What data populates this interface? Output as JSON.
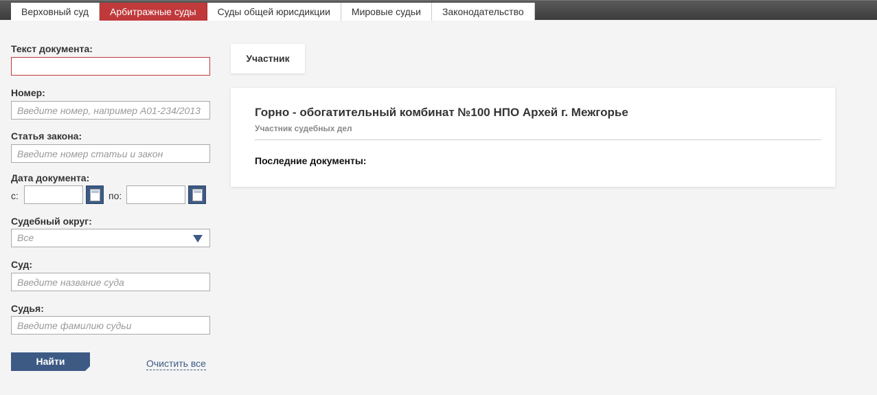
{
  "tabs": [
    {
      "label": "Верховный суд",
      "active": false
    },
    {
      "label": "Арбитражные суды",
      "active": true
    },
    {
      "label": "Суды общей юрисдикции",
      "active": false
    },
    {
      "label": "Мировые судьи",
      "active": false
    },
    {
      "label": "Законодательство",
      "active": false
    }
  ],
  "filters": {
    "text_label": "Текст документа:",
    "text_value": "",
    "number_label": "Номер:",
    "number_placeholder": "Введите номер, например А01-234/2013",
    "article_label": "Статья закона:",
    "article_placeholder": "Введите номер статьи и закон",
    "date_label": "Дата документа:",
    "date_from_label": "с:",
    "date_to_label": "по:",
    "district_label": "Судебный округ:",
    "district_value": "Все",
    "court_label": "Суд:",
    "court_placeholder": "Введите название суда",
    "judge_label": "Судья:",
    "judge_placeholder": "Введите фамилию судьи",
    "find_label": "Найти",
    "clear_label": "Очистить все"
  },
  "participant_tab": "Участник",
  "card": {
    "title": "Горно - обогатительный комбинат №100 НПО Архей г. Межгорье",
    "subtitle": "Участник судебных дел",
    "docs_label": "Последние документы:"
  },
  "colors": {
    "accent_red": "#c0393b",
    "accent_blue": "#3d5a85",
    "background": "#f4f4f4"
  }
}
